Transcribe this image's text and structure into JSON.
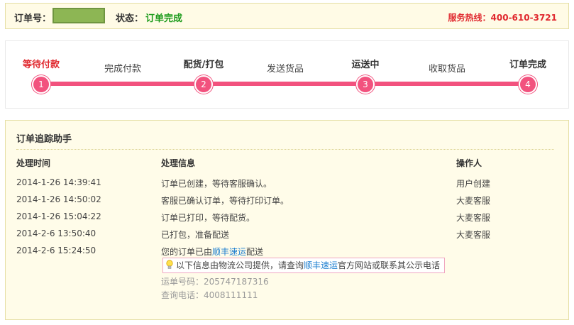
{
  "header": {
    "order_no_label": "订单号：",
    "status_label": "状态：",
    "status_value": "订单完成",
    "hotline": "服务热线：400-610-3721"
  },
  "progress": {
    "steps": [
      {
        "label": "等待付款",
        "number": "1",
        "kind": "major",
        "current": true
      },
      {
        "label": "完成付款",
        "kind": "minor"
      },
      {
        "label": "配货/打包",
        "number": "2",
        "kind": "major"
      },
      {
        "label": "发送货品",
        "kind": "minor"
      },
      {
        "label": "运送中",
        "number": "3",
        "kind": "major"
      },
      {
        "label": "收取货品",
        "kind": "minor"
      },
      {
        "label": "订单完成",
        "number": "4",
        "kind": "major"
      }
    ]
  },
  "tracking": {
    "title": "订单追踪助手",
    "columns": {
      "time": "处理时间",
      "info": "处理信息",
      "operator": "操作人"
    },
    "rows": [
      {
        "time": "2014-1-26 14:39:41",
        "info": "订单已创建，等待客服确认。",
        "operator": "用户创建"
      },
      {
        "time": "2014-1-26 14:50:02",
        "info": "客服已确认订单，等待打印订单。",
        "operator": "大麦客服"
      },
      {
        "time": "2014-1-26 15:04:22",
        "info": "订单已打印，等待配货。",
        "operator": "大麦客服"
      },
      {
        "time": "2014-2-6 13:50:40",
        "info": "已打包，准备配送",
        "operator": "大麦客服"
      },
      {
        "time": "2014-2-6 15:24:50",
        "info_prefix": "您的订单已由",
        "info_link": "顺丰速运",
        "info_suffix": "配送",
        "operator": ""
      }
    ],
    "note": {
      "prefix": "以下信息由物流公司提供，请查询",
      "link": "顺丰速运",
      "suffix": "官方网站或联系其公示电话"
    },
    "waybill": "运单号码：205747187316",
    "phone": "查询电话：4008111111"
  }
}
